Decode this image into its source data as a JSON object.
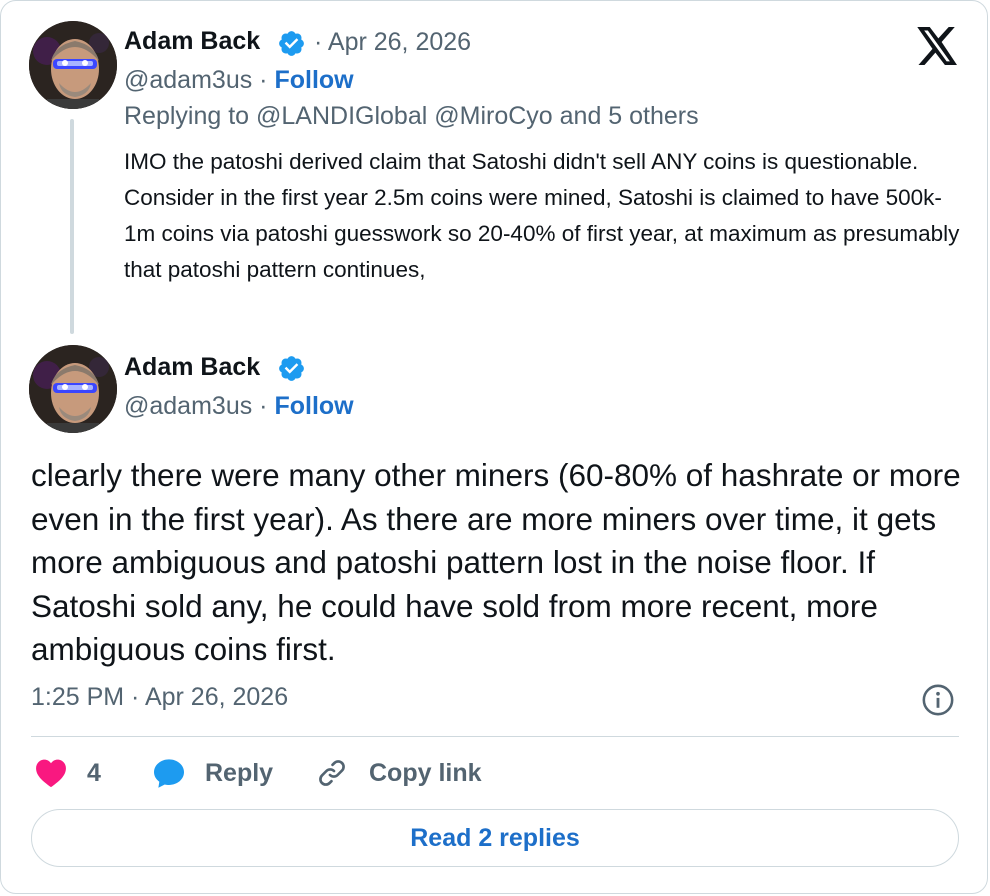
{
  "reply_tweet": {
    "author_name": "Adam Back",
    "date": "· Apr 26, 2026",
    "handle": "@adam3us ·",
    "follow_label": "Follow",
    "replying_to": "Replying to @LANDIGlobal @MiroCyo and 5 others",
    "body": "IMO the patoshi derived claim that Satoshi didn't sell ANY coins is questionable. Consider in the first year 2.5m coins were mined, Satoshi is claimed to have 500k-1m coins via patoshi guesswork so 20-40% of first year, at maximum as presumably that patoshi pattern continues,"
  },
  "main_tweet": {
    "author_name": "Adam Back",
    "handle": "@adam3us ·",
    "follow_label": "Follow",
    "body": "clearly there were many other miners (60-80% of hashrate or more even in the first year). As there are more miners over time, it gets more ambiguous and patoshi pattern lost in the noise floor. If Satoshi sold any, he could have  sold from more recent, more ambiguous coins first.",
    "timestamp": "1:25 PM · Apr 26, 2026"
  },
  "actions": {
    "like_count": "4",
    "reply_label": "Reply",
    "copy_link_label": "Copy link"
  },
  "read_replies_label": "Read 2 replies",
  "colors": {
    "accent": "#1d6fc9",
    "verified": "#1d9bf0",
    "heart": "#f91880",
    "muted": "#536471",
    "border": "#cfd9de"
  },
  "icons": [
    "verified-badge-icon",
    "x-logo-icon",
    "info-icon",
    "heart-icon",
    "reply-bubble-icon",
    "link-icon"
  ]
}
